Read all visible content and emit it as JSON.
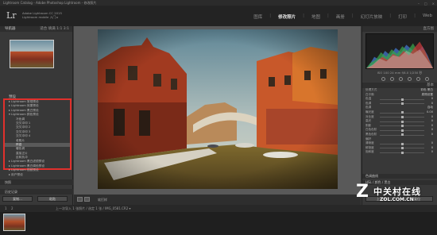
{
  "window": {
    "title": "Lightroom Catalog - Adobe Photoshop Lightroom - 修改照片",
    "controls": [
      "–",
      "□",
      "×"
    ]
  },
  "topbar": {
    "logo": "Lr",
    "identity_line1": "Adobe Lightroom CC 2015",
    "identity_line2": "Lightroom mobile 入门 ▸",
    "modules": [
      "图库",
      "修改照片",
      "地图",
      "画册",
      "幻灯片放映",
      "打印",
      "Web"
    ],
    "active_module": "修改照片"
  },
  "left": {
    "navigator_title": "导航器",
    "navigator_right": "适合 填满 1:1 3:1",
    "presets_title": "预设",
    "preset_items": [
      {
        "label": "▸ Lightroom 常规预设",
        "child": false
      },
      {
        "label": "▸ Lightroom 效果预设",
        "child": false
      },
      {
        "label": "▸ Lightroom 黑白预设",
        "child": false
      },
      {
        "label": "▾ Lightroom 颜色预设",
        "child": false
      },
      {
        "label": "冷色调",
        "child": true
      },
      {
        "label": "交叉冲印 1",
        "child": true
      },
      {
        "label": "交叉冲印 2",
        "child": true
      },
      {
        "label": "交叉冲印 3",
        "child": true
      },
      {
        "label": "交叉冲印 4",
        "child": true
      },
      {
        "label": "老照片",
        "child": true
      },
      {
        "label": "怀旧",
        "child": true
      },
      {
        "label": "暖色调",
        "child": true
      },
      {
        "label": "直接正片",
        "child": true
      },
      {
        "label": "反转负冲",
        "child": true
      },
      {
        "label": "▸ Lightroom 黑白滤镜预设",
        "child": false
      },
      {
        "label": "▸ Lightroom 黑白调色预设",
        "child": false
      },
      {
        "label": "▸ Lightroom 视频预设",
        "child": false
      },
      {
        "label": "▸ 用户预设",
        "child": false
      }
    ],
    "selected_preset_index": 10,
    "snapshots_title": "快照",
    "history_title": "历史记录",
    "copy_button": "复制...",
    "paste_button": "粘贴"
  },
  "toolbar": {
    "label": "软打样"
  },
  "right": {
    "histogram_title": "直方图",
    "histogram_info": "ISO 100   24 mm   f/8.0   1/250 秒",
    "basic_title": "基本",
    "rows": [
      {
        "label": "处理方式",
        "value": "彩色 黑白",
        "slider": null
      },
      {
        "label": "白平衡",
        "value": "原照设置",
        "slider": null
      },
      {
        "label": "色温",
        "value": "0",
        "slider": 0.5
      },
      {
        "label": "色调",
        "value": "0",
        "slider": 0.5
      },
      {
        "label": "色调",
        "value": "自动",
        "slider": null
      },
      {
        "label": "曝光度",
        "value": "0.00",
        "slider": 0.5
      },
      {
        "label": "对比度",
        "value": "0",
        "slider": 0.5
      },
      {
        "label": "高光",
        "value": "0",
        "slider": 0.5
      },
      {
        "label": "阴影",
        "value": "0",
        "slider": 0.5
      },
      {
        "label": "白色色阶",
        "value": "0",
        "slider": 0.5
      },
      {
        "label": "黑色色阶",
        "value": "0",
        "slider": 0.5
      },
      {
        "label": "偏好",
        "value": "",
        "slider": null
      },
      {
        "label": "清晰度",
        "value": "0",
        "slider": 0.5
      },
      {
        "label": "鲜艳度",
        "value": "0",
        "slider": 0.5
      },
      {
        "label": "饱和度",
        "value": "0",
        "slider": 0.5
      }
    ],
    "tone_curve_title": "色调曲线",
    "hsl_title": "HSL / 颜色 / 黑白",
    "prev_button": "上一张",
    "reset_button": "复位"
  },
  "filmstrip": {
    "page_nums": [
      "1",
      "2"
    ],
    "path": "上一次导入   1 张照片 / 选定 1 张 / IMG_0581.CR2 ▾"
  },
  "watermark": {
    "logo": "Z",
    "text": "中关村在线",
    "sub": "ZOL.COM.CN"
  }
}
